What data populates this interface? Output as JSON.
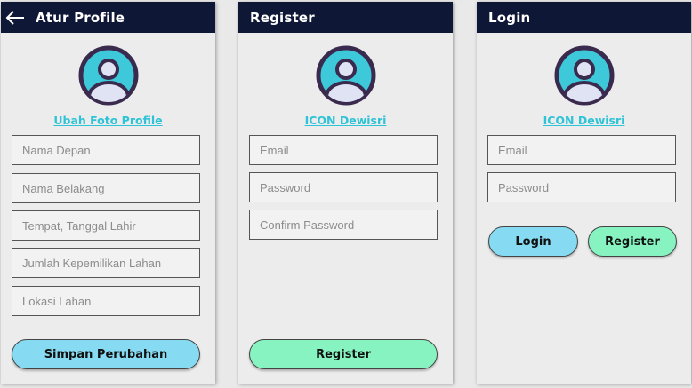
{
  "colors": {
    "appbar": "#0e1735",
    "link": "#2ec3d6",
    "button_blue": "#86daf1",
    "button_green": "#86f3c0",
    "avatar_fill": "#3ec9da",
    "avatar_stroke": "#3a2a4e"
  },
  "profile_screen": {
    "title": "Atur Profile",
    "back_icon": "arrow-left-icon",
    "avatar_link": "Ubah Foto Profile",
    "fields": [
      {
        "placeholder": "Nama Depan"
      },
      {
        "placeholder": "Nama Belakang"
      },
      {
        "placeholder": "Tempat, Tanggal Lahir"
      },
      {
        "placeholder": "Jumlah Kepemilikan Lahan"
      },
      {
        "placeholder": "Lokasi Lahan"
      }
    ],
    "save_button": "Simpan Perubahan"
  },
  "register_screen": {
    "title": "Register",
    "avatar_label": "ICON Dewisri",
    "fields": [
      {
        "placeholder": "Email"
      },
      {
        "placeholder": "Password"
      },
      {
        "placeholder": "Confirm Password"
      }
    ],
    "register_button": "Register"
  },
  "login_screen": {
    "title": "Login",
    "avatar_label": "ICON Dewisri",
    "fields": [
      {
        "placeholder": "Email"
      },
      {
        "placeholder": "Password"
      }
    ],
    "login_button": "Login",
    "register_button": "Register"
  }
}
